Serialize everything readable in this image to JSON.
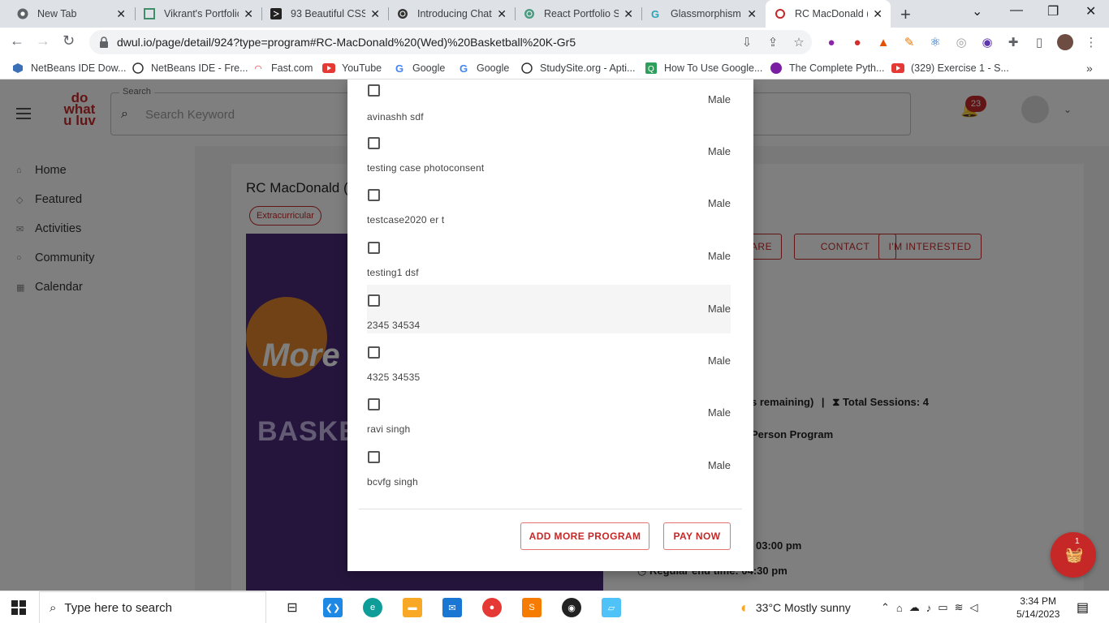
{
  "browser": {
    "tabs": [
      {
        "title": "New Tab",
        "icon": "chrome-icon",
        "active": false
      },
      {
        "title": "Vikrant's Portfolio",
        "icon": "portfolio-icon",
        "active": false
      },
      {
        "title": "93 Beautiful CSS",
        "icon": "css-icon",
        "active": false
      },
      {
        "title": "Introducing Chat",
        "icon": "openai-icon",
        "active": false
      },
      {
        "title": "React Portfolio Si",
        "icon": "openai-icon",
        "active": false
      },
      {
        "title": "Glassmorphism C",
        "icon": "glass-icon",
        "active": false
      },
      {
        "title": "RC MacDonald (W",
        "icon": "dwul-icon",
        "active": true
      }
    ],
    "url": "dwul.io/page/detail/924?type=program#RC-MacDonald%20(Wed)%20Basketball%20K-Gr5",
    "bookmarks": [
      "NetBeans IDE Dow...",
      "NetBeans IDE - Fre...",
      "Fast.com",
      "YouTube",
      "Google",
      "Google",
      "StudySite.org - Apti...",
      "How To Use Google...",
      "The Complete Pyth...",
      "(329) Exercise 1 - S..."
    ]
  },
  "app": {
    "logo_lines": [
      "do",
      "what",
      "u luv"
    ],
    "search_label": "Search",
    "search_placeholder": "Search Keyword",
    "notif_count": "23",
    "sidebar": [
      "Home",
      "Featured",
      "Activities",
      "Community",
      "Calendar"
    ],
    "page_title": "RC MacDonald (",
    "chip": "Extracurricular",
    "banner_text_1": "More",
    "banner_text_2": "BASKET",
    "buttons": [
      "ARE",
      "CONTACT",
      "I'M INTERESTED"
    ],
    "sessions_text": "s remaining)",
    "total_sessions_label": "Total Sessions:",
    "total_sessions_value": "4",
    "person_program": "Person Program",
    "start_time": "03:00 pm",
    "end_time_label": "Regular end time:",
    "end_time": "04:30 pm",
    "cart_count": "1"
  },
  "dialog": {
    "rows": [
      {
        "name": "avinashh sdf",
        "gender": "Male"
      },
      {
        "name": "testing case photoconsent",
        "gender": "Male"
      },
      {
        "name": "testcase2020 er t",
        "gender": "Male"
      },
      {
        "name": "testing1 dsf",
        "gender": "Male"
      },
      {
        "name": "2345 34534",
        "gender": "Male"
      },
      {
        "name": "4325 34535",
        "gender": "Male"
      },
      {
        "name": "ravi singh",
        "gender": "Male"
      },
      {
        "name": "bcvfg singh",
        "gender": "Male"
      }
    ],
    "add_more": "ADD MORE PROGRAM",
    "pay_now": "PAY NOW"
  },
  "taskbar": {
    "search_placeholder": "Type here to search",
    "weather": "33°C  Mostly sunny",
    "time": "3:34 PM",
    "date": "5/14/2023"
  },
  "colors": {
    "accent": "#c62828",
    "purple": "#4a2a7a"
  }
}
